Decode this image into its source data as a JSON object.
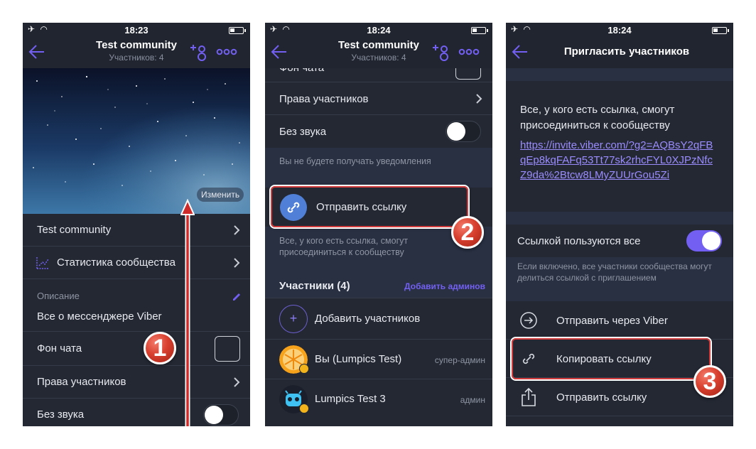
{
  "screen1": {
    "status": {
      "time": "18:23"
    },
    "header": {
      "title": "Test community",
      "subtitle": "Участников: 4"
    },
    "cover": {
      "edit_label": "Изменить"
    },
    "rows": {
      "name": "Test community",
      "stats": "Статистика сообщества",
      "description_label": "Описание",
      "description_value": "Все о мессенджере Viber",
      "chat_bg": "Фон чата",
      "permissions": "Права участников",
      "mute": "Без звука"
    },
    "step": "1"
  },
  "screen2": {
    "status": {
      "time": "18:24"
    },
    "header": {
      "title": "Test community",
      "subtitle": "Участников: 4"
    },
    "rows": {
      "chat_bg_partial": "Фон чата",
      "permissions": "Права участников",
      "mute": "Без звука",
      "mute_hint": "Вы не будете получать уведомления",
      "send_link": "Отправить ссылку",
      "send_link_hint": "Все, у кого есть ссылка, смогут присоединиться к сообществу"
    },
    "members": {
      "header": "Участники (4)",
      "add_admins": "Добавить админов",
      "add_members": "Добавить участников",
      "list": [
        {
          "name": "Вы (Lumpics Test)",
          "role": "супер-админ"
        },
        {
          "name": "Lumpics Test 3",
          "role": "админ"
        }
      ]
    },
    "step": "2"
  },
  "screen3": {
    "status": {
      "time": "18:24"
    },
    "header": {
      "title": "Пригласить участников"
    },
    "info": {
      "text": "Все, у кого есть ссылка, смогут присоединиться к сообществу",
      "link": "https://invite.viber.com/?g2=AQBsY2qFBqEp8kqFAFq53Tt77sk2rhcFYL0XJPzNfcZ9da%2Btcw8LMyZUUrGou5Zi"
    },
    "link_toggle": {
      "label": "Ссылкой пользуются все",
      "hint": "Если включено, все участники сообщества могут делиться ссылкой с приглашением"
    },
    "actions": {
      "send_viber": "Отправить через Viber",
      "copy_link": "Копировать ссылку",
      "send_link": "Отправить ссылку"
    },
    "step": "3"
  },
  "colors": {
    "background": "#232833",
    "accent": "#7360f2",
    "link": "#9b8cff",
    "callout": "#d13b3b",
    "arrow": "#cf2a2a"
  }
}
